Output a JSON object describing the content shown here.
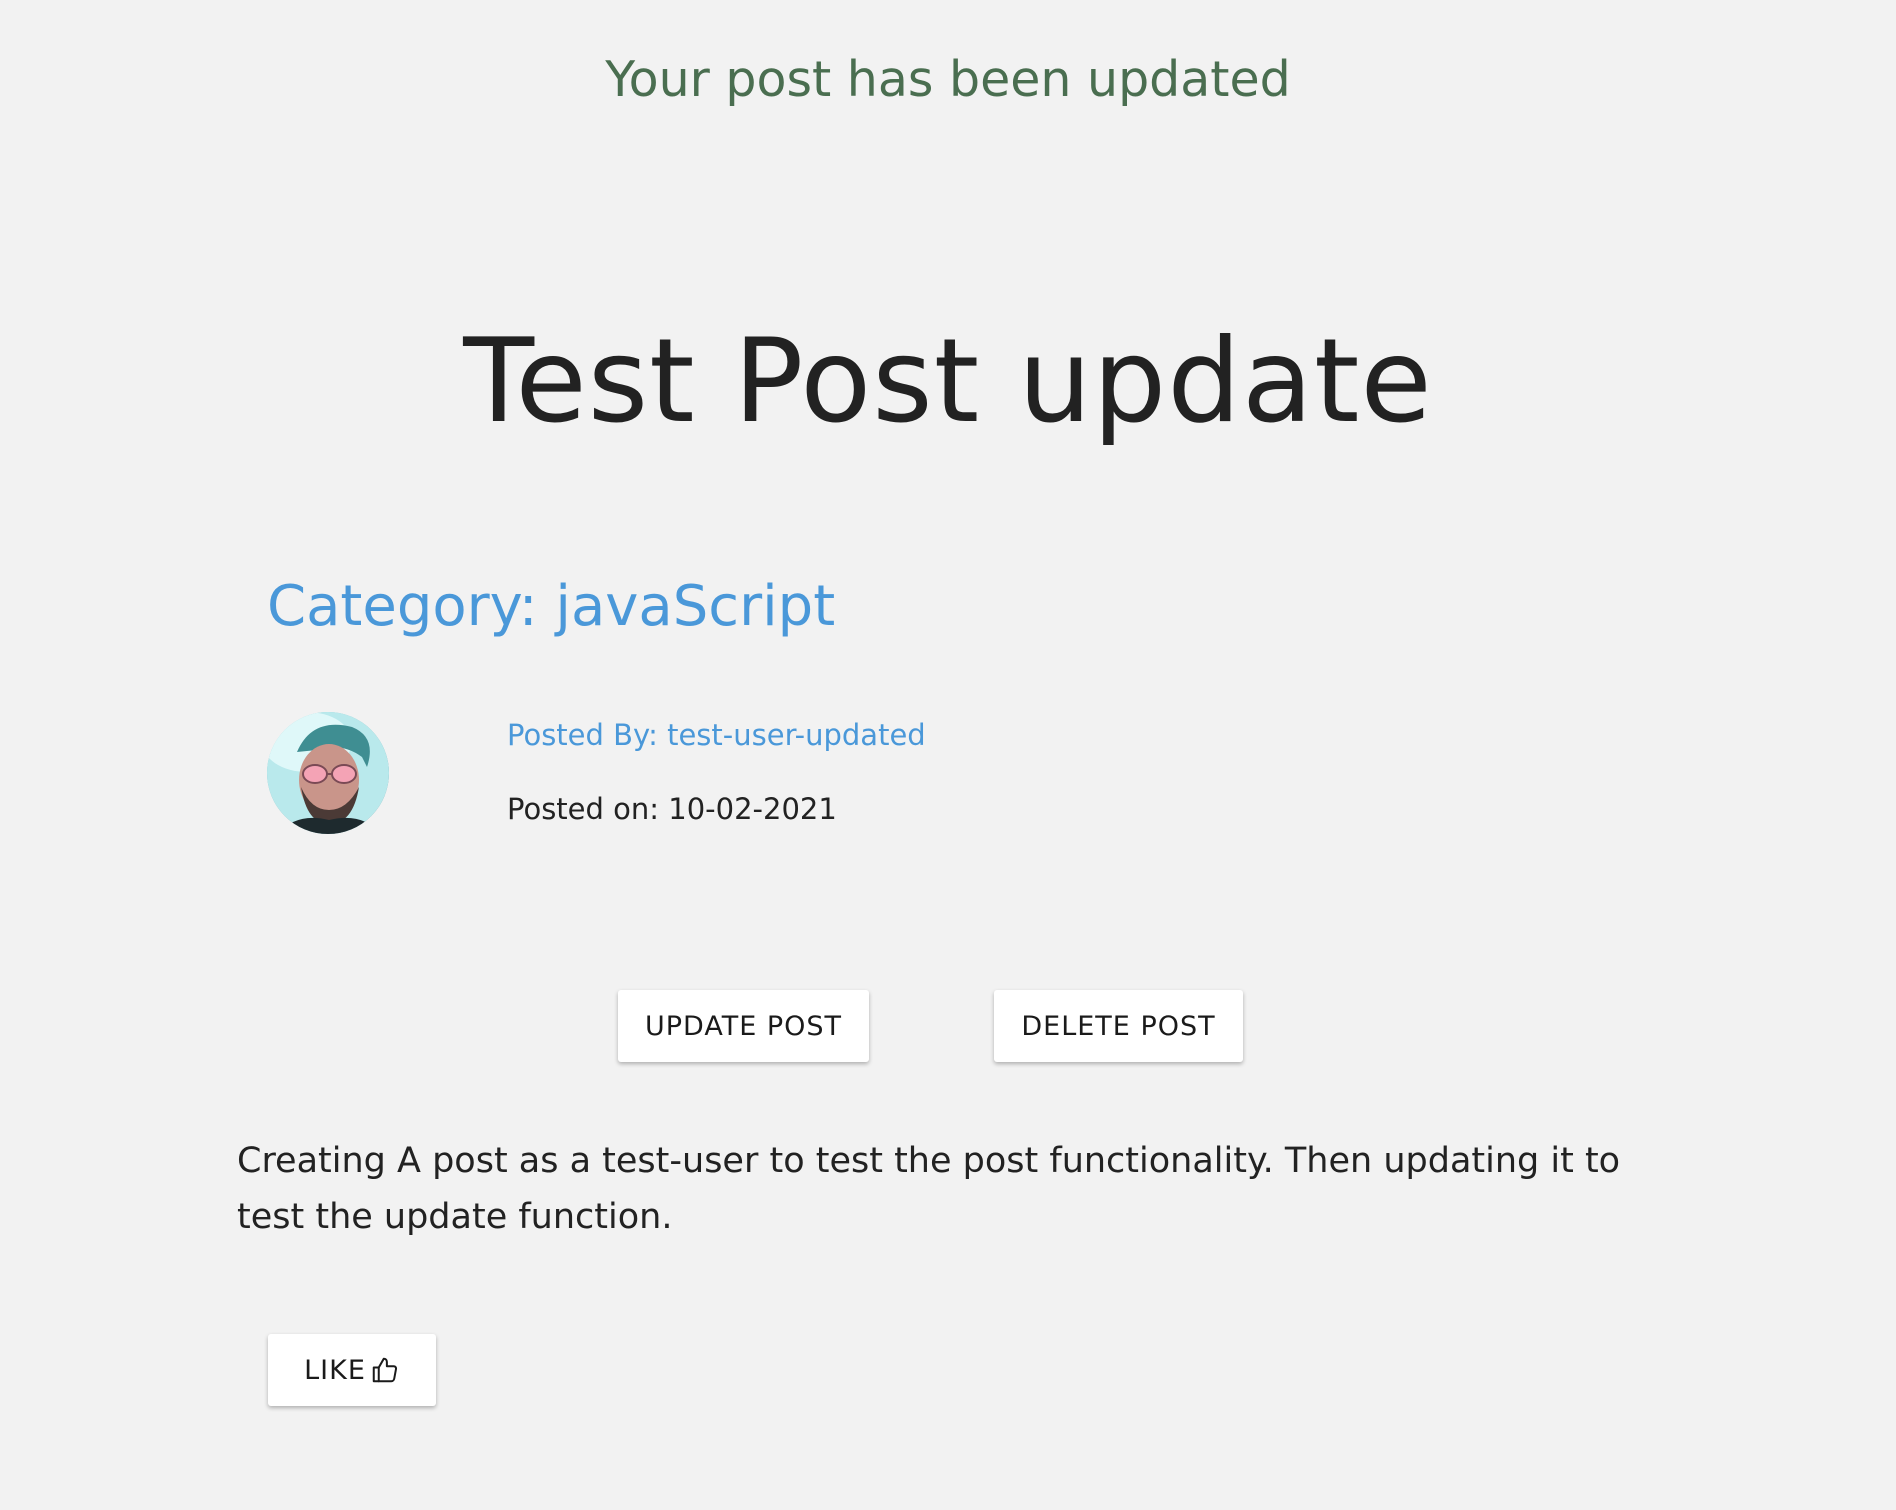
{
  "flash": {
    "message": "Your post has been updated",
    "color": "#4a6e50"
  },
  "post": {
    "title": "Test Post update",
    "category": "Category: javaScript",
    "posted_by": "Posted By: test-user-updated",
    "posted_on": "Posted on: 10-02-2021",
    "body": "Creating A post as a test-user to test the post functionality. Then updating it to test the update function."
  },
  "actions": {
    "update_label": "UPDATE POST",
    "delete_label": "DELETE POST",
    "like_label": "LIKE",
    "like_icon": "thumbs-up-icon"
  },
  "colors": {
    "background": "#f2f2f2",
    "accent_blue": "#4a98d9",
    "success_green": "#4a6e50"
  }
}
